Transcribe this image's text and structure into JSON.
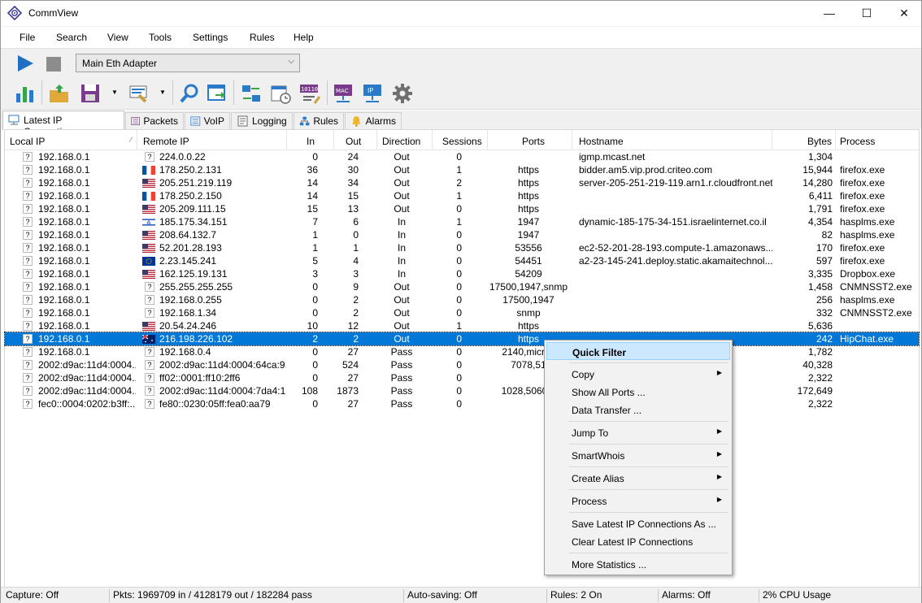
{
  "app": {
    "title": "CommView"
  },
  "window_controls": {
    "minimize": "—",
    "maximize": "☐",
    "close": "✕"
  },
  "menu": [
    "File",
    "Search",
    "View",
    "Tools",
    "Settings",
    "Rules",
    "Help"
  ],
  "adapter": {
    "selected": "Main Eth Adapter"
  },
  "toolbar_icons": [
    "statistics-icon",
    "open-folder-icon",
    "save-icon",
    "clear-icon",
    "search-icon",
    "save-log-icon",
    "nic-icon",
    "schedule-icon",
    "decode-icon",
    "mac-alias-icon",
    "ip-alias-icon",
    "gear-icon"
  ],
  "tabs": [
    {
      "label": "Latest IP Connections",
      "icon": "connections-icon",
      "active": true
    },
    {
      "label": "Packets",
      "icon": "packets-icon"
    },
    {
      "label": "VoIP",
      "icon": "voip-icon"
    },
    {
      "label": "Logging",
      "icon": "logging-icon"
    },
    {
      "label": "Rules",
      "icon": "rules-icon"
    },
    {
      "label": "Alarms",
      "icon": "bell-icon"
    }
  ],
  "columns": [
    "Local IP",
    "Remote IP",
    "In",
    "Out",
    "Direction",
    "Sessions",
    "Ports",
    "Hostname",
    "Bytes",
    "Process"
  ],
  "rows": [
    {
      "local": "192.168.0.1",
      "flag": "none",
      "remote": "224.0.0.22",
      "in": "0",
      "out": "24",
      "dir": "Out",
      "sess": "0",
      "ports": "",
      "host": "igmp.mcast.net",
      "bytes": "1,304",
      "proc": ""
    },
    {
      "local": "192.168.0.1",
      "flag": "fr",
      "remote": "178.250.2.131",
      "in": "36",
      "out": "30",
      "dir": "Out",
      "sess": "1",
      "ports": "https",
      "host": "bidder.am5.vip.prod.criteo.com",
      "bytes": "15,944",
      "proc": "firefox.exe"
    },
    {
      "local": "192.168.0.1",
      "flag": "us",
      "remote": "205.251.219.119",
      "in": "14",
      "out": "34",
      "dir": "Out",
      "sess": "2",
      "ports": "https",
      "host": "server-205-251-219-119.arn1.r.cloudfront.net",
      "bytes": "14,280",
      "proc": "firefox.exe"
    },
    {
      "local": "192.168.0.1",
      "flag": "fr",
      "remote": "178.250.2.150",
      "in": "14",
      "out": "15",
      "dir": "Out",
      "sess": "1",
      "ports": "https",
      "host": "",
      "bytes": "6,411",
      "proc": "firefox.exe"
    },
    {
      "local": "192.168.0.1",
      "flag": "us",
      "remote": "205.209.111.15",
      "in": "15",
      "out": "13",
      "dir": "Out",
      "sess": "0",
      "ports": "https",
      "host": "",
      "bytes": "1,791",
      "proc": "firefox.exe"
    },
    {
      "local": "192.168.0.1",
      "flag": "il",
      "remote": "185.175.34.151",
      "in": "7",
      "out": "6",
      "dir": "In",
      "sess": "1",
      "ports": "1947",
      "host": "dynamic-185-175-34-151.israelinternet.co.il",
      "bytes": "4,354",
      "proc": "hasplms.exe"
    },
    {
      "local": "192.168.0.1",
      "flag": "us",
      "remote": "208.64.132.7",
      "in": "1",
      "out": "0",
      "dir": "In",
      "sess": "0",
      "ports": "1947",
      "host": "",
      "bytes": "82",
      "proc": "hasplms.exe"
    },
    {
      "local": "192.168.0.1",
      "flag": "us",
      "remote": "52.201.28.193",
      "in": "1",
      "out": "1",
      "dir": "In",
      "sess": "0",
      "ports": "53556",
      "host": "ec2-52-201-28-193.compute-1.amazonaws...",
      "bytes": "170",
      "proc": "firefox.exe"
    },
    {
      "local": "192.168.0.1",
      "flag": "eu",
      "remote": "2.23.145.241",
      "in": "5",
      "out": "4",
      "dir": "In",
      "sess": "0",
      "ports": "54451",
      "host": "a2-23-145-241.deploy.static.akamaitechnol...",
      "bytes": "597",
      "proc": "firefox.exe"
    },
    {
      "local": "192.168.0.1",
      "flag": "us",
      "remote": "162.125.19.131",
      "in": "3",
      "out": "3",
      "dir": "In",
      "sess": "0",
      "ports": "54209",
      "host": "",
      "bytes": "3,335",
      "proc": "Dropbox.exe"
    },
    {
      "local": "192.168.0.1",
      "flag": "none",
      "remote": "255.255.255.255",
      "in": "0",
      "out": "9",
      "dir": "Out",
      "sess": "0",
      "ports": "17500,1947,snmp",
      "host": "",
      "bytes": "1,458",
      "proc": "CNMNSST2.exe"
    },
    {
      "local": "192.168.0.1",
      "flag": "none",
      "remote": "192.168.0.255",
      "in": "0",
      "out": "2",
      "dir": "Out",
      "sess": "0",
      "ports": "17500,1947",
      "host": "",
      "bytes": "256",
      "proc": "hasplms.exe"
    },
    {
      "local": "192.168.0.1",
      "flag": "none",
      "remote": "192.168.1.34",
      "in": "0",
      "out": "2",
      "dir": "Out",
      "sess": "0",
      "ports": "snmp",
      "host": "",
      "bytes": "332",
      "proc": "CNMNSST2.exe"
    },
    {
      "local": "192.168.0.1",
      "flag": "us",
      "remote": "20.54.24.246",
      "in": "10",
      "out": "12",
      "dir": "Out",
      "sess": "1",
      "ports": "https",
      "host": "",
      "bytes": "5,636",
      "proc": ""
    },
    {
      "local": "192.168.0.1",
      "flag": "au",
      "remote": "216.198.226.102",
      "in": "2",
      "out": "2",
      "dir": "Out",
      "sess": "0",
      "ports": "https",
      "host": "",
      "bytes": "242",
      "proc": "HipChat.exe",
      "selected": true
    },
    {
      "local": "192.168.0.1",
      "flag": "none",
      "remote": "192.168.0.4",
      "in": "0",
      "out": "27",
      "dir": "Pass",
      "sess": "0",
      "ports": "2140,micros",
      "host": "",
      "bytes": "1,782",
      "proc": ""
    },
    {
      "local": "2002:d9ac:11d4:0004...",
      "flag": "none",
      "remote": "2002:d9ac:11d4:0004:64ca:9...",
      "in": "0",
      "out": "524",
      "dir": "Pass",
      "sess": "0",
      "ports": "7078,51",
      "host": "",
      "bytes": "40,328",
      "proc": ""
    },
    {
      "local": "2002:d9ac:11d4:0004...",
      "flag": "none",
      "remote": "ff02::0001:ff10:2ff6",
      "in": "0",
      "out": "27",
      "dir": "Pass",
      "sess": "0",
      "ports": "",
      "host": "",
      "bytes": "2,322",
      "proc": ""
    },
    {
      "local": "2002:d9ac:11d4:0004...",
      "flag": "none",
      "remote": "2002:d9ac:11d4:0004:7da4:1...",
      "in": "108",
      "out": "1873",
      "dir": "Pass",
      "sess": "0",
      "ports": "1028,5060,5",
      "host": "",
      "bytes": "172,649",
      "proc": ""
    },
    {
      "local": "fec0::0004:0202:b3ff:...",
      "flag": "none",
      "remote": "fe80::0230:05ff:fea0:aa79",
      "in": "0",
      "out": "27",
      "dir": "Pass",
      "sess": "0",
      "ports": "",
      "host": "",
      "bytes": "2,322",
      "proc": ""
    }
  ],
  "context_menu": [
    {
      "label": "Quick Filter",
      "highlight": true
    },
    {
      "label": "Copy",
      "sub": true
    },
    {
      "label": "Show All Ports ..."
    },
    {
      "label": "Data Transfer ..."
    },
    {
      "label": "Jump To",
      "sub": true
    },
    {
      "label": "SmartWhois",
      "sub": true
    },
    {
      "label": "Create Alias",
      "sub": true
    },
    {
      "label": "Process",
      "sub": true
    },
    {
      "label": "Save Latest IP Connections As ..."
    },
    {
      "label": "Clear Latest IP Connections"
    },
    {
      "label": "More Statistics ..."
    }
  ],
  "status": {
    "capture": "Capture: Off",
    "packets": "Pkts: 1969709 in / 4128179 out / 182284 pass",
    "autosave": "Auto-saving: Off",
    "rules": "Rules: 2 On",
    "alarms": "Alarms: Off",
    "cpu": "2% CPU Usage"
  }
}
